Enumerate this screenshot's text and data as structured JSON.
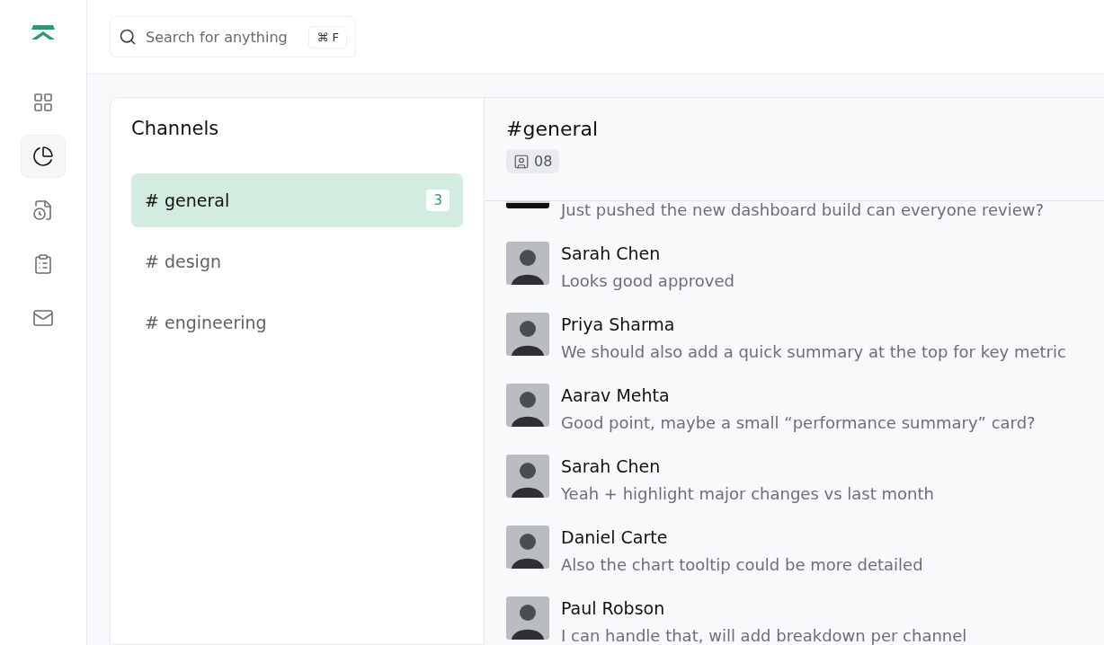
{
  "nav": [
    {
      "selected": false
    },
    {
      "selected": true
    },
    {
      "selected": false
    },
    {
      "selected": false
    },
    {
      "selected": false
    }
  ],
  "search": {
    "placeholder": "Search for anything",
    "shortcut": "⌘ F"
  },
  "channels_panel": {
    "title": "Channels",
    "items": [
      {
        "label": "# general",
        "badge": "3",
        "selected": true
      },
      {
        "label": "# design",
        "selected": false
      },
      {
        "label": "# engineering",
        "selected": false
      }
    ]
  },
  "chat": {
    "title": "#general",
    "members": "08",
    "messages": [
      {
        "kind": "partial",
        "text": "Just pushed the new dashboard build can everyone review?"
      },
      {
        "kind": "full",
        "name": "Sarah Chen",
        "text": "Looks good approved"
      },
      {
        "kind": "full",
        "name": "Priya Sharma",
        "text": "We should also add a quick summary at the top for key metric"
      },
      {
        "kind": "full",
        "name": "Aarav Mehta",
        "text": "Good point, maybe a small “performance summary” card?"
      },
      {
        "kind": "full",
        "name": "Sarah Chen",
        "text": "Yeah + highlight major changes vs last month"
      },
      {
        "kind": "full",
        "name": "Daniel Carte",
        "text": "Also the chart tooltip could be more detailed"
      },
      {
        "kind": "full",
        "name": "Paul Robson",
        "text": "I can handle that, will add breakdown per channel"
      }
    ]
  }
}
